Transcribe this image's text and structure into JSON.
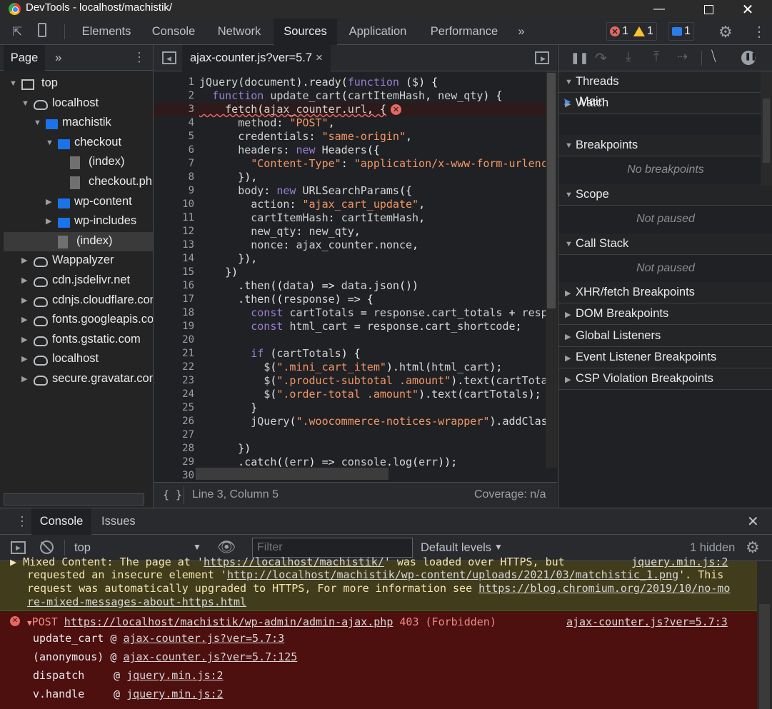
{
  "window": {
    "title": "DevTools - localhost/machistik/",
    "controls": [
      "minimize",
      "maximize",
      "close"
    ]
  },
  "toolbar": {
    "tabs": [
      "Elements",
      "Console",
      "Network",
      "Sources",
      "Application",
      "Performance"
    ],
    "active_tab": "Sources",
    "more": "»",
    "error_count": "1",
    "warning_count": "1",
    "message_count": "1"
  },
  "navigator": {
    "tab": "Page",
    "more": "»",
    "tree": [
      {
        "label": "top",
        "depth": 0,
        "type": "frame",
        "open": true
      },
      {
        "label": "localhost",
        "depth": 1,
        "type": "cloud",
        "open": true
      },
      {
        "label": "machistik",
        "depth": 2,
        "type": "folder",
        "open": true
      },
      {
        "label": "checkout",
        "depth": 3,
        "type": "folder",
        "open": true
      },
      {
        "label": "(index)",
        "depth": 4,
        "type": "file"
      },
      {
        "label": "checkout.php",
        "depth": 4,
        "type": "file"
      },
      {
        "label": "wp-content",
        "depth": 3,
        "type": "folder",
        "open": false
      },
      {
        "label": "wp-includes",
        "depth": 3,
        "type": "folder",
        "open": false
      },
      {
        "label": "(index)",
        "depth": 3,
        "type": "file",
        "selected": true
      },
      {
        "label": "Wappalyzer",
        "depth": 1,
        "type": "cloud",
        "open": false
      },
      {
        "label": "cdn.jsdelivr.net",
        "depth": 1,
        "type": "cloud",
        "open": false
      },
      {
        "label": "cdnjs.cloudflare.com",
        "depth": 1,
        "type": "cloud",
        "open": false
      },
      {
        "label": "fonts.googleapis.com",
        "depth": 1,
        "type": "cloud",
        "open": false
      },
      {
        "label": "fonts.gstatic.com",
        "depth": 1,
        "type": "cloud",
        "open": false
      },
      {
        "label": "localhost",
        "depth": 1,
        "type": "cloud",
        "open": false
      },
      {
        "label": "secure.gravatar.com",
        "depth": 1,
        "type": "cloud",
        "open": false
      }
    ]
  },
  "editor": {
    "file_tab": "ajax-counter.js?ver=5.7",
    "close": "×",
    "line_numbers": [
      "1",
      "2",
      "3",
      "4",
      "5",
      "6",
      "7",
      "8",
      "9",
      "10",
      "11",
      "12",
      "13",
      "14",
      "15",
      "16",
      "17",
      "18",
      "19",
      "20",
      "21",
      "22",
      "23",
      "24",
      "25",
      "26",
      "27",
      "28",
      "29",
      "30"
    ],
    "lines": [
      "jQuery(document).ready(function ($) {",
      "  function update_cart(cartItemHash, new_qty) {",
      "    fetch(ajax_counter.url, {",
      "      method: \"POST\",",
      "      credentials: \"same-origin\",",
      "      headers: new Headers({",
      "        \"Content-Type\": \"application/x-www-form-urlenc",
      "      }),",
      "      body: new URLSearchParams({",
      "        action: \"ajax_cart_update\",",
      "        cartItemHash: cartItemHash,",
      "        new_qty: new_qty,",
      "        nonce: ajax_counter.nonce,",
      "      }),",
      "    })",
      "      .then((data) => data.json())",
      "      .then((response) => {",
      "        const cartTotals = response.cart_totals + resp",
      "        const html_cart = response.cart_shortcode;",
      "",
      "        if (cartTotals) {",
      "          $(\".mini_cart_item\").html(html_cart);",
      "          $(\".product-subtotal .amount\").text(cartTota",
      "          $(\".order-total .amount\").text(cartTotals);",
      "        }",
      "        jQuery(\".woocommerce-notices-wrapper\").addClas",
      "",
      "      })",
      "      .catch((err) => console.log(err));",
      ""
    ],
    "cursor": "Line 3, Column 5",
    "coverage": "Coverage: n/a",
    "format_icon": "{ }"
  },
  "debugger": {
    "sections": [
      {
        "title": "Threads",
        "open": true
      },
      {
        "title": "Watch",
        "open": false
      },
      {
        "title": "Breakpoints",
        "open": true
      },
      {
        "title": "Scope",
        "open": true
      },
      {
        "title": "Call Stack",
        "open": true
      },
      {
        "title": "XHR/fetch Breakpoints",
        "open": false
      },
      {
        "title": "DOM Breakpoints",
        "open": false
      },
      {
        "title": "Global Listeners",
        "open": false
      },
      {
        "title": "Event Listener Breakpoints",
        "open": false
      },
      {
        "title": "CSP Violation Breakpoints",
        "open": false
      }
    ],
    "thread_main": "Main",
    "no_breakpoints": "No breakpoints",
    "scope_status": "Not paused",
    "callstack_status": "Not paused"
  },
  "drawer": {
    "tabs": [
      "Console",
      "Issues"
    ],
    "context": "top",
    "filter_placeholder": "Filter",
    "levels": "Default levels",
    "hidden": "1 hidden"
  },
  "console": {
    "warning": {
      "line1_text": "Mixed Content: The page at '",
      "line1_link": "https://localhost/machistik/",
      "line1_rest": "' was loaded over HTTPS, but",
      "line1_source": "jquery.min.js:2",
      "line2_text": "requested an insecure element '",
      "line2_link": "http://localhost/machistik/wp-content/uploads/2021/03/matchistic_1.png",
      "line2_rest": "'. This",
      "line3_text": "request was automatically upgraded to HTTPS, For more information see ",
      "line3_link": "https://blog.chromium.org/2019/10/no-mo",
      "line4_link": "re-mixed-messages-about-https.html"
    },
    "error": {
      "method": "POST",
      "url": "https://localhost/machistik/wp-admin/admin-ajax.php",
      "status": "403 (Forbidden)",
      "source": "ajax-counter.js?ver=5.7:3",
      "stack": [
        {
          "fn": "update_cart",
          "at": "@",
          "src": "ajax-counter.js?ver=5.7:3"
        },
        {
          "fn": "(anonymous)",
          "at": "@",
          "src": "ajax-counter.js?ver=5.7:125"
        },
        {
          "fn": "dispatch",
          "at": "@",
          "src": "jquery.min.js:2"
        },
        {
          "fn": "v.handle",
          "at": "@",
          "src": "jquery.min.js:2"
        }
      ]
    }
  },
  "colors": {
    "background": "#202124",
    "accent": "#1a73e8",
    "error_bg": "#4e0f0f",
    "warning_bg": "#413c1c"
  }
}
